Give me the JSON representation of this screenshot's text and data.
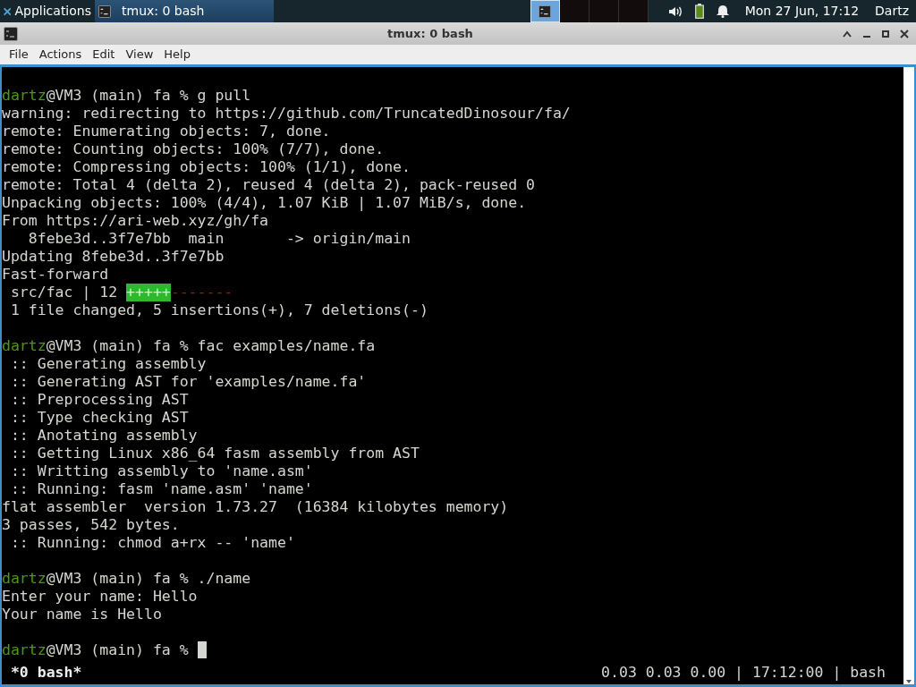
{
  "panel": {
    "apps_menu": "Applications",
    "tasks": [
      {
        "label": "tmux: 0 bash",
        "selected": true
      }
    ],
    "workspaces": [
      {
        "selected": true,
        "has_window": true
      },
      {
        "selected": false,
        "has_window": false
      },
      {
        "selected": false,
        "has_window": false
      },
      {
        "selected": false,
        "has_window": false
      }
    ],
    "clock": "Mon 27 Jun, 17:12",
    "user": "Dartz"
  },
  "window": {
    "title": "tmux: 0 bash",
    "menu": [
      "File",
      "Actions",
      "Edit",
      "View",
      "Help"
    ]
  },
  "terminal": {
    "lines": [
      {
        "kind": "blank"
      },
      {
        "kind": "prompt",
        "user": "dartz",
        "rest": "@VM3 (main) fa % g pull"
      },
      {
        "kind": "output",
        "text": "warning: redirecting to https://github.com/TruncatedDinosour/fa/"
      },
      {
        "kind": "output",
        "text": "remote: Enumerating objects: 7, done."
      },
      {
        "kind": "output",
        "text": "remote: Counting objects: 100% (7/7), done."
      },
      {
        "kind": "output",
        "text": "remote: Compressing objects: 100% (1/1), done."
      },
      {
        "kind": "output",
        "text": "remote: Total 4 (delta 2), reused 4 (delta 2), pack-reused 0"
      },
      {
        "kind": "output",
        "text": "Unpacking objects: 100% (4/4), 1.07 KiB | 1.07 MiB/s, done."
      },
      {
        "kind": "output",
        "text": "From https://ari-web.xyz/gh/fa"
      },
      {
        "kind": "output",
        "text": "   8febe3d..3f7e7bb  main       -> origin/main"
      },
      {
        "kind": "output",
        "text": "Updating 8febe3d..3f7e7bb"
      },
      {
        "kind": "output",
        "text": "Fast-forward"
      },
      {
        "kind": "diffstat",
        "text": " src/fac | 12 ",
        "plus": "+++++",
        "minus": "-------"
      },
      {
        "kind": "output",
        "text": " 1 file changed, 5 insertions(+), 7 deletions(-)"
      },
      {
        "kind": "blank"
      },
      {
        "kind": "prompt",
        "user": "dartz",
        "rest": "@VM3 (main) fa % fac examples/name.fa"
      },
      {
        "kind": "output",
        "text": " :: Generating assembly"
      },
      {
        "kind": "output",
        "text": " :: Generating AST for 'examples/name.fa'"
      },
      {
        "kind": "output",
        "text": " :: Preprocessing AST"
      },
      {
        "kind": "output",
        "text": " :: Type checking AST"
      },
      {
        "kind": "output",
        "text": " :: Anotating assembly"
      },
      {
        "kind": "output",
        "text": " :: Getting Linux x86_64 fasm assembly from AST"
      },
      {
        "kind": "output",
        "text": " :: Writting assembly to 'name.asm'"
      },
      {
        "kind": "output",
        "text": " :: Running: fasm 'name.asm' 'name'"
      },
      {
        "kind": "output",
        "text": "flat assembler  version 1.73.27  (16384 kilobytes memory)"
      },
      {
        "kind": "output",
        "text": "3 passes, 542 bytes."
      },
      {
        "kind": "output",
        "text": " :: Running: chmod a+rx -- 'name'"
      },
      {
        "kind": "blank"
      },
      {
        "kind": "prompt",
        "user": "dartz",
        "rest": "@VM3 (main) fa % ./name"
      },
      {
        "kind": "output",
        "text": "Enter your name: Hello"
      },
      {
        "kind": "output",
        "text": "Your name is Hello"
      },
      {
        "kind": "blank"
      },
      {
        "kind": "prompt",
        "user": "dartz",
        "rest": "@VM3 (main) fa % ",
        "cursor": true
      }
    ],
    "status_left": " *0 bash*",
    "status_right": "0.03 0.03 0.00 | 17:12:00 | bash"
  }
}
